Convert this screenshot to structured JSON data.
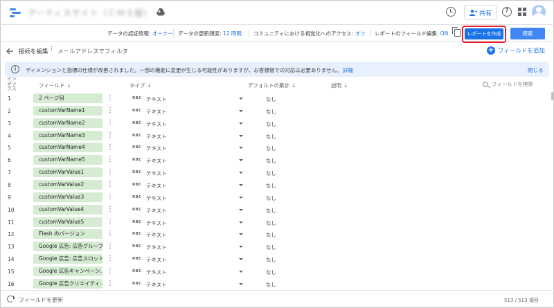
{
  "header": {
    "title": "アーティスサイト（ＣＭＳ版）",
    "share_label": "共有"
  },
  "toolbar": {
    "credential_label": "データの認証情報:",
    "credential_value": "オーナー",
    "freshness_label": "データの更新頻度:",
    "freshness_value": "12 時間",
    "community_label": "コミュニティにおける視覚化へのアクセス:",
    "community_value": "オフ",
    "field_edit_label": "レポートのフィールド編集:",
    "field_edit_value": "ON",
    "create_report_label": "レポートを作成",
    "explore_label": "探索"
  },
  "subheader": {
    "edit_connection": "接続を編集",
    "datasource_name": "メールアドレスでフィルタ",
    "add_field": "フィールドを追加"
  },
  "banner": {
    "message": "ディメンションと指標の仕様が改善されました。一部の機能に変更が生じる可能性がありますが、お客様側での対応は必要ありません。",
    "detail_link": "詳細",
    "close_link": "閉じる"
  },
  "table": {
    "col_index": "インデックス",
    "col_field": "フィールド",
    "col_type": "タイプ",
    "col_default_agg": "デフォルトの集計",
    "col_description": "説明",
    "search_placeholder": "フィールドを検索",
    "rows": [
      {
        "index": "1",
        "field": "2 ページ目",
        "abc": "RBC",
        "type": "テキスト",
        "agg": "なし"
      },
      {
        "index": "2",
        "field": "customVarName1",
        "abc": "RBC",
        "type": "テキスト",
        "agg": "なし"
      },
      {
        "index": "3",
        "field": "customVarName2",
        "abc": "RBC",
        "type": "テキスト",
        "agg": "なし"
      },
      {
        "index": "4",
        "field": "customVarName3",
        "abc": "RBC",
        "type": "テキスト",
        "agg": "なし"
      },
      {
        "index": "5",
        "field": "customVarName4",
        "abc": "RBC",
        "type": "テキスト",
        "agg": "なし"
      },
      {
        "index": "6",
        "field": "customVarName5",
        "abc": "RBC",
        "type": "テキスト",
        "agg": "なし"
      },
      {
        "index": "7",
        "field": "customVarValue1",
        "abc": "RBC",
        "type": "テキスト",
        "agg": "なし"
      },
      {
        "index": "8",
        "field": "customVarValue2",
        "abc": "RBC",
        "type": "テキスト",
        "agg": "なし"
      },
      {
        "index": "9",
        "field": "customVarValue3",
        "abc": "RBC",
        "type": "テキスト",
        "agg": "なし"
      },
      {
        "index": "10",
        "field": "customVarValue4",
        "abc": "RBC",
        "type": "テキスト",
        "agg": "なし"
      },
      {
        "index": "11",
        "field": "customVarValue5",
        "abc": "RBC",
        "type": "テキスト",
        "agg": "なし"
      },
      {
        "index": "12",
        "field": "Flash のバージョン",
        "abc": "RBC",
        "type": "テキスト",
        "agg": "なし"
      },
      {
        "index": "13",
        "field": "Google 広告: 広告グループ",
        "abc": "RBC",
        "type": "テキスト",
        "agg": "なし"
      },
      {
        "index": "14",
        "field": "Google 広告: 広告スロット",
        "abc": "RBC",
        "type": "テキスト",
        "agg": "なし"
      },
      {
        "index": "15",
        "field": "Google 広告キャンペーン...",
        "abc": "RBC",
        "type": "テキスト",
        "agg": "なし"
      },
      {
        "index": "16",
        "field": "Google 広告クリエイティ...",
        "abc": "RBC",
        "type": "テキスト",
        "agg": "なし"
      }
    ]
  },
  "footer": {
    "refresh_label": "フィールドを更新",
    "count": "513 / 513 項目"
  },
  "colors": {
    "primary": "#1a73e8",
    "chip": "#d6ecd2",
    "banner": "#e8f0fe",
    "highlight": "#e8212b"
  }
}
